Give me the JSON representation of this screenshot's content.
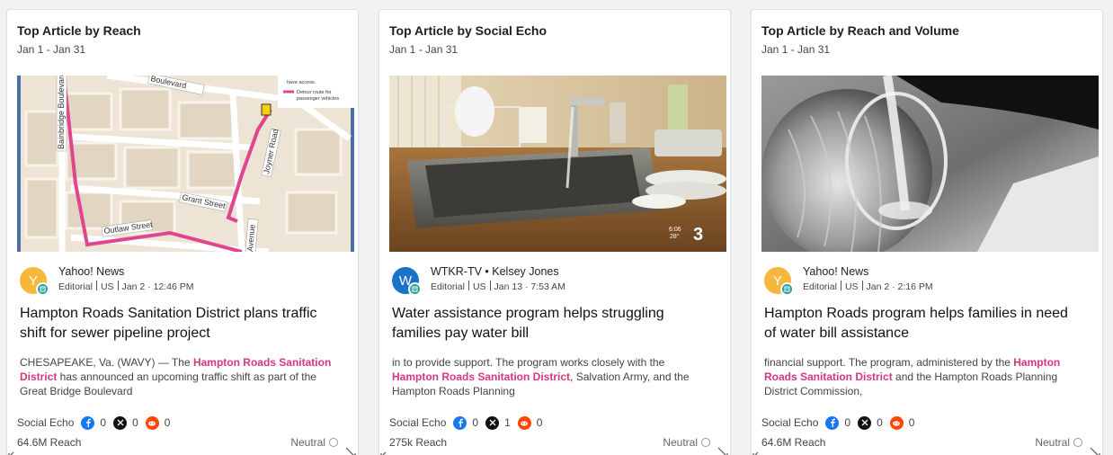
{
  "cards": [
    {
      "title": "Top Article by Reach",
      "date_range": "Jan 1 - Jan 31",
      "thumbnail": "map-image",
      "source": {
        "avatar_letter": "Y",
        "avatar_color": "#f6b73c",
        "name": "Yahoo! News",
        "type": "Editorial",
        "country": "US",
        "date": "Jan 2 · 12:46 PM"
      },
      "headline": "Hampton Roads Sanitation District plans traffic shift for sewer pipeline project",
      "snippet": {
        "before": "CHESAPEAKE, Va. (WAVY) — The ",
        "highlight": "Hampton Roads Sanitation District",
        "after": " has announced an upcoming traffic shift as part of the Great Bridge Boulevard"
      },
      "social_echo": {
        "label": "Social Echo",
        "facebook": "0",
        "x": "0",
        "reddit": "0"
      },
      "reach": "64.6M Reach",
      "sentiment": "Neutral"
    },
    {
      "title": "Top Article by Social Echo",
      "date_range": "Jan 1 - Jan 31",
      "thumbnail": "kitchen-sink-image",
      "source": {
        "avatar_letter": "W",
        "avatar_color": "#1a73c9",
        "name": "WTKR-TV • Kelsey Jones",
        "type": "Editorial",
        "country": "US",
        "date": "Jan 13 · 7:53 AM"
      },
      "headline": "Water assistance program helps struggling families pay water bill",
      "snippet": {
        "before": "in to provide support. The program works closely with the ",
        "highlight": "Hampton Roads Sanitation District",
        "after": ", Salvation Army, and the Hampton Roads Planning"
      },
      "social_echo": {
        "label": "Social Echo",
        "facebook": "0",
        "x": "1",
        "reddit": "0"
      },
      "reach": "275k Reach",
      "sentiment": "Neutral",
      "thumb_overlay": {
        "time": "6:06",
        "temp": "28°",
        "channel": "3"
      }
    },
    {
      "title": "Top Article by Reach and Volume",
      "date_range": "Jan 1 - Jan 31",
      "thumbnail": "water-glass-image",
      "source": {
        "avatar_letter": "Y",
        "avatar_color": "#f6b73c",
        "name": "Yahoo! News",
        "type": "Editorial",
        "country": "US",
        "date": "Jan 2 · 2:16 PM"
      },
      "headline": "Hampton Roads program helps families in need of water bill assistance",
      "snippet": {
        "before": "financial support. The program, administered by the ",
        "highlight": "Hampton Roads Sanitation District",
        "after": " and the Hampton Roads Planning District Commission,"
      },
      "social_echo": {
        "label": "Social Echo",
        "facebook": "0",
        "x": "0",
        "reddit": "0"
      },
      "reach": "64.6M Reach",
      "sentiment": "Neutral"
    }
  ],
  "map_labels": {
    "street1": "Bainbridge Boulevard",
    "street2": "Boulevard",
    "street3": "Joyner Road",
    "street4": "Grant Street",
    "street5": "Outlaw Street",
    "street6": "Avenue",
    "legend1": "have access.",
    "legend2": "Detour route for passenger vehicles"
  },
  "colors": {
    "highlight": "#d6367e",
    "facebook": "#1877f2",
    "x": "#111111",
    "reddit": "#ff4500",
    "detour": "#e0458f"
  }
}
